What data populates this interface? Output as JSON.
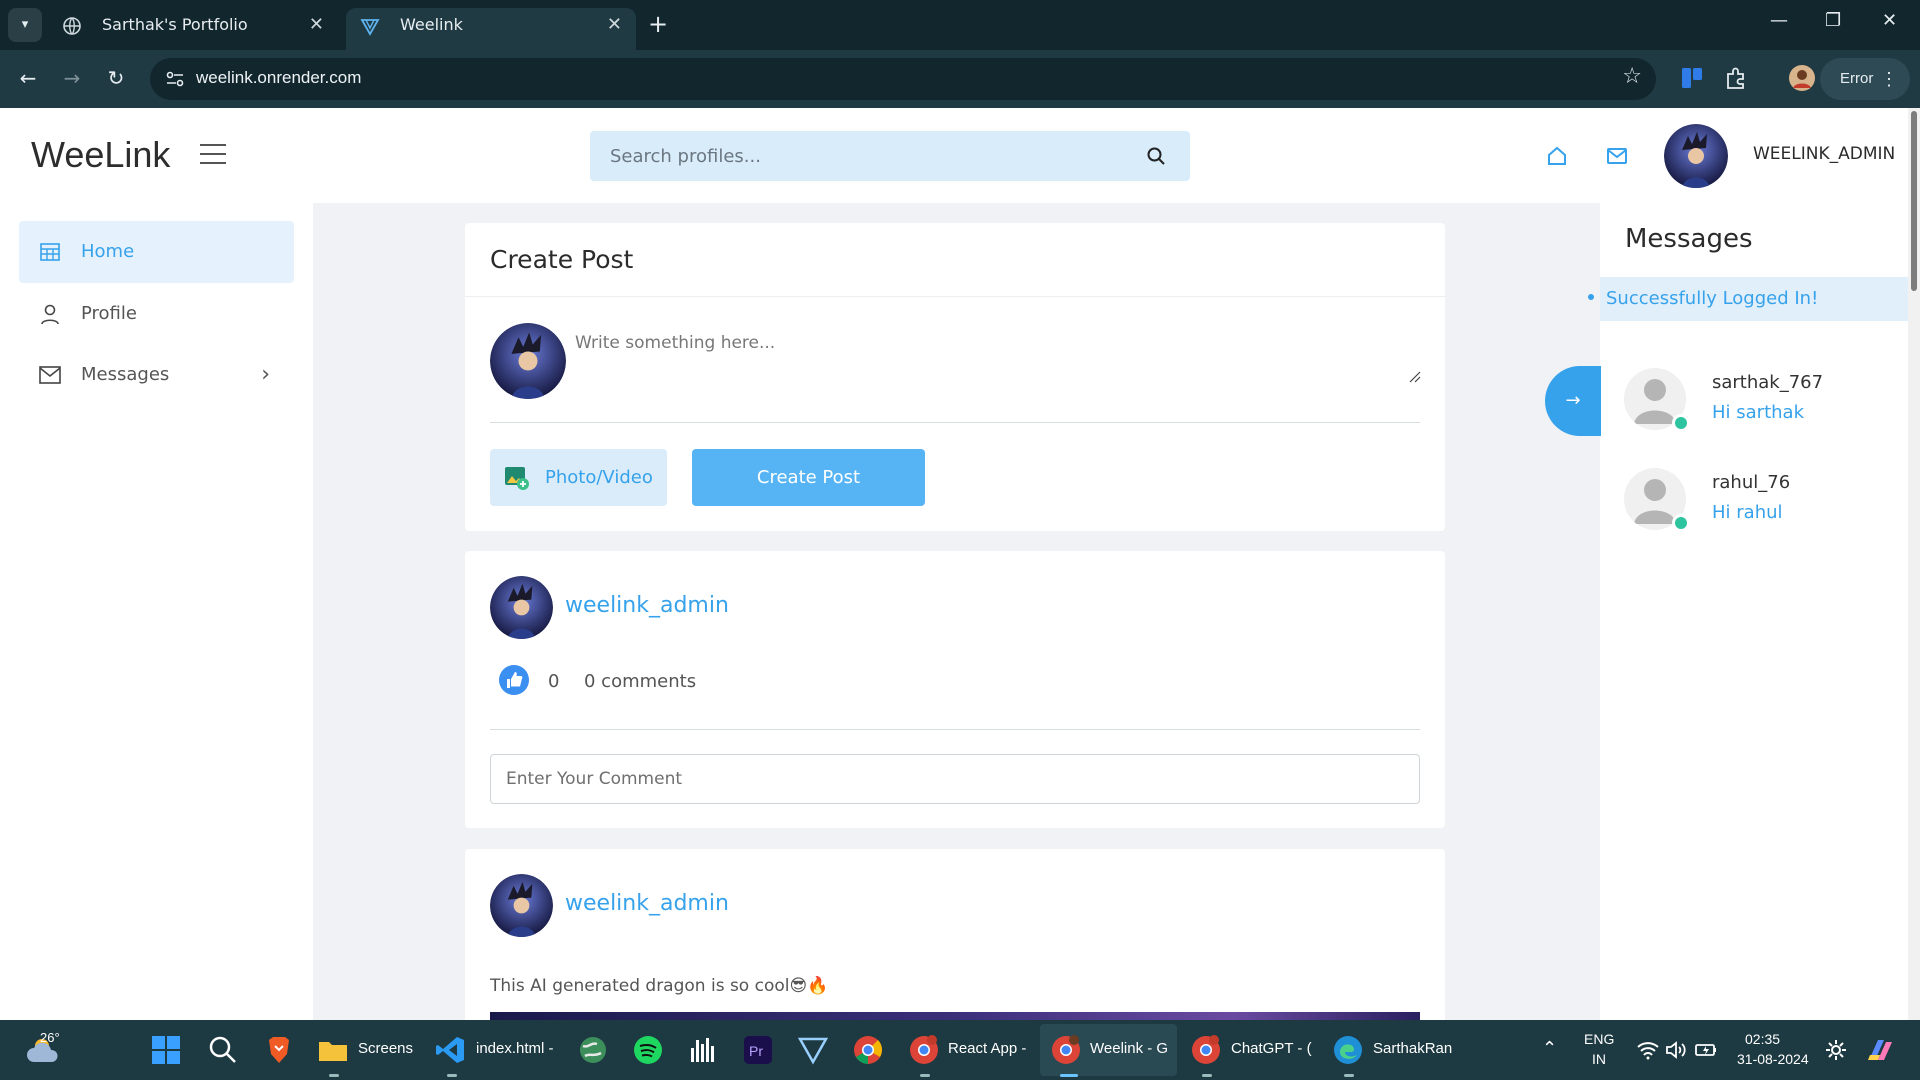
{
  "browser": {
    "tabs": [
      {
        "title": "Sarthak's Portfolio",
        "icon": "globe-icon"
      },
      {
        "title": "Weelink",
        "icon": "weelink-logo-icon"
      }
    ],
    "url": "weelink.onrender.com",
    "profile_status": "Error"
  },
  "app": {
    "logo": "WeeLink",
    "search_placeholder": "Search profiles...",
    "username": "WEELINK_ADMIN",
    "accent_color": "#36a2eb",
    "sidebar": [
      {
        "label": "Home",
        "icon": "home-grid-icon",
        "active": true
      },
      {
        "label": "Profile",
        "icon": "user-icon",
        "active": false
      },
      {
        "label": "Messages",
        "icon": "mail-icon",
        "active": false,
        "has_submenu": true
      }
    ],
    "create_post": {
      "title": "Create Post",
      "placeholder": "Write something here...",
      "photo_button": "Photo/Video",
      "submit_button": "Create Post"
    },
    "posts": [
      {
        "author": "weelink_admin",
        "likes": "0",
        "comments": "0 comments",
        "comment_placeholder": "Enter Your Comment"
      },
      {
        "author": "weelink_admin",
        "text": "This AI generated dragon is so cool😎🔥"
      }
    ],
    "messages_panel": {
      "title": "Messages",
      "notice": "Successfully Logged In!",
      "contacts": [
        {
          "name": "sarthak_767",
          "last_message": "Hi sarthak",
          "online": true
        },
        {
          "name": "rahul_76",
          "last_message": "Hi rahul",
          "online": true
        }
      ]
    }
  },
  "taskbar": {
    "weather_temp": "26°",
    "apps": [
      {
        "label": "Screens"
      },
      {
        "label": "index.html -"
      },
      {
        "label": "React App -"
      },
      {
        "label": "Weelink - G"
      },
      {
        "label": "ChatGPT - ("
      },
      {
        "label": "SarthakRan"
      }
    ],
    "lang": "ENG",
    "region": "IN",
    "time": "02:35",
    "date": "31-08-2024"
  }
}
